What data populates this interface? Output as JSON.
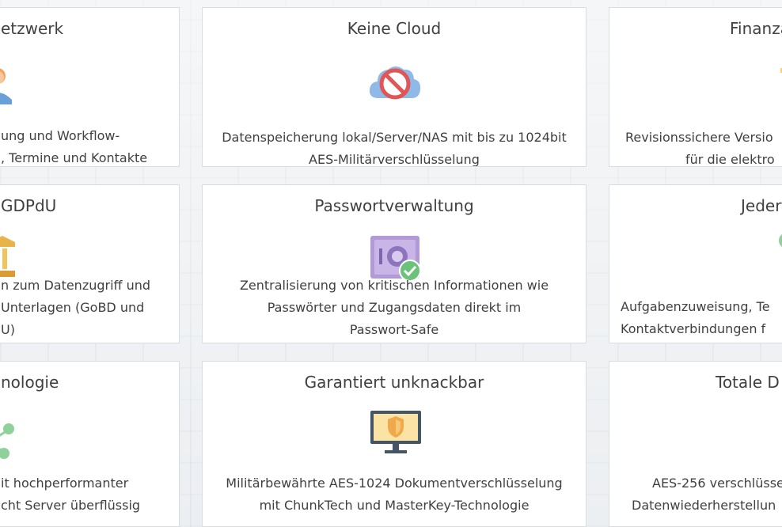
{
  "cards": [
    {
      "title": "etzwerk",
      "lines": [
        "ung und Workflow-",
        ", Termine und Kontakte"
      ]
    },
    {
      "title": "Keine Cloud",
      "icon": "no-cloud-icon",
      "lines": [
        "Datenspeicherung lokal/Server/NAS mit bis zu 1024bit",
        "AES-Militärverschlüsselung"
      ]
    },
    {
      "title": "Finanza",
      "lines": [
        "Revisionssichere Versio",
        "für die elektro"
      ]
    },
    {
      "title": "GDPdU",
      "lines": [
        "n zum Datenzugriff und",
        "Unterlagen (GoBD und",
        "U)"
      ]
    },
    {
      "title": "Passwortverwaltung",
      "icon": "password-safe-icon",
      "lines": [
        "Zentralisierung von kritischen Informationen wie",
        "Passwörter und Zugangsdaten direkt im",
        "Passwort-Safe"
      ]
    },
    {
      "title": "Jeder",
      "lines": [
        "Aufgabenzuweisung, Te",
        "Kontaktverbindungen f"
      ]
    },
    {
      "title": "nologie",
      "lines": [
        "it hochperformanter",
        "cht Server überflüssig"
      ]
    },
    {
      "title": "Garantiert unknackbar",
      "icon": "secure-monitor-icon",
      "lines": [
        "Militärbewährte AES-1024 Dokumentverschlüsselung",
        "mit ChunkTech und MasterKey-Technologie"
      ]
    },
    {
      "title": "Totale D",
      "lines": [
        "AES-256 verschlüsse",
        "Datenwiederherstellun"
      ]
    }
  ]
}
